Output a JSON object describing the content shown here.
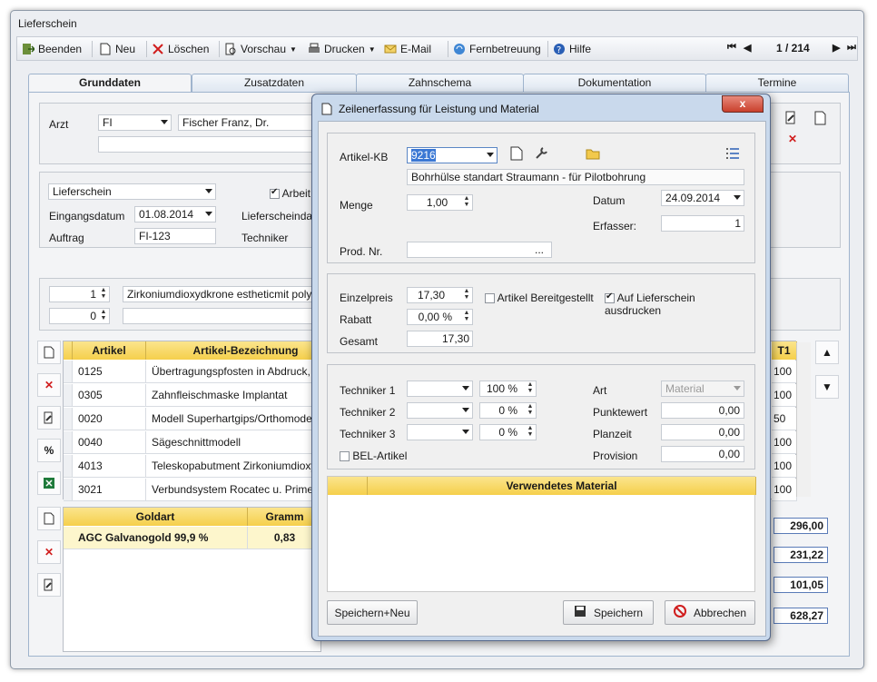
{
  "window": {
    "title": "Lieferschein"
  },
  "toolbar": {
    "beenden": "Beenden",
    "neu": "Neu",
    "loeschen": "Löschen",
    "vorschau": "Vorschau",
    "drucken": "Drucken",
    "email": "E-Mail",
    "fernbetreuung": "Fernbetreuung",
    "hilfe": "Hilfe",
    "page": "1 / 214"
  },
  "tabs": [
    "Grunddaten",
    "Zusatzdaten",
    "Zahnschema",
    "Dokumentation",
    "Termine"
  ],
  "grunddaten": {
    "arzt_label": "Arzt",
    "arzt_code": "FI",
    "arzt_name": "Fischer Franz, Dr.",
    "typ": "Lieferschein",
    "arbeit_label": "Arbeit",
    "eingangsdatum_label": "Eingangsdatum",
    "eingangsdatum": "01.08.2014",
    "lieferscheindatum_label": "Lieferscheindat",
    "auftrag_label": "Auftrag",
    "auftrag": "FI-123",
    "techniker_label": "Techniker",
    "pos1_qty": "1",
    "pos1_text": "Zirkoniumdioxydkrone estheticmit poly",
    "pos2_qty": "0"
  },
  "artikel_table": {
    "headers": [
      "Artikel",
      "Artikel-Bezeichnung",
      "T1"
    ],
    "rows": [
      {
        "artikel": "0125",
        "bez": "Übertragungspfosten in Abdruck, B",
        "t1": "100"
      },
      {
        "artikel": "0305",
        "bez": "Zahnfleischmaske Implantat",
        "t1": "100"
      },
      {
        "artikel": "0020",
        "bez": "Modell Superhartgips/Orthomodell",
        "t1": "50"
      },
      {
        "artikel": "0040",
        "bez": "Sägeschnittmodell",
        "t1": "100"
      },
      {
        "artikel": "4013",
        "bez": "Teleskopabutment Zirkoniumdioxyd",
        "t1": "100"
      },
      {
        "artikel": "3021",
        "bez": "Verbundsystem Rocatec u. Primer T",
        "t1": "100"
      }
    ]
  },
  "gold_table": {
    "headers": [
      "Goldart",
      "Gramm"
    ],
    "rows": [
      {
        "goldart": "AGC Galvanogold 99,9 %",
        "gramm": "0,83"
      }
    ]
  },
  "totals": [
    "296,00",
    "231,22",
    "101,05",
    "628,27"
  ],
  "dialog": {
    "title": "Zeilenerfassung für Leistung und Material",
    "close": "x",
    "artikel_kb_label": "Artikel-KB",
    "artikel_kb": "9216",
    "artikel_desc": "Bohrhülse standart Straumann - für Pilotbohrung",
    "menge_label": "Menge",
    "menge": "1,00",
    "datum_label": "Datum",
    "datum": "24.09.2014",
    "erfasser_label": "Erfasser:",
    "erfasser": "1",
    "prod_nr_label": "Prod. Nr.",
    "prod_nr_btn": "...",
    "einzelpreis_label": "Einzelpreis",
    "einzelpreis": "17,30",
    "rabatt_label": "Rabatt",
    "rabatt": "0,00 %",
    "gesamt_label": "Gesamt",
    "gesamt": "17,30",
    "bereitgestellt_label": "Artikel Bereitgestellt",
    "auf_lieferschein_label": "Auf Lieferschein ausdrucken",
    "techniker1_label": "Techniker 1",
    "techniker1_pct": "100 %",
    "techniker2_label": "Techniker 2",
    "techniker2_pct": "0 %",
    "techniker3_label": "Techniker 3",
    "techniker3_pct": "0 %",
    "bel_label": "BEL-Artikel",
    "art_label": "Art",
    "art": "Material",
    "punktewert_label": "Punktewert",
    "punktewert": "0,00",
    "planzeit_label": "Planzeit",
    "planzeit": "0,00",
    "provision_label": "Provision",
    "provision": "0,00",
    "material_header": "Verwendetes Material",
    "btn_speichern_neu": "Speichern+Neu",
    "btn_speichern": "Speichern",
    "btn_abbrechen": "Abbrechen"
  }
}
